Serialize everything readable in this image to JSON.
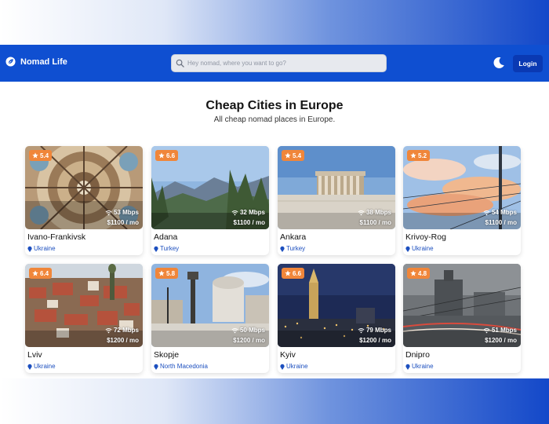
{
  "app": {
    "brand_name": "Nomad Life",
    "colors": {
      "navbar": "#0f4fd1",
      "login": "#0a39b3",
      "rating_badge": "#f0863a",
      "country_link": "#1c4fbf"
    }
  },
  "header": {
    "search_placeholder": "Hey nomad, where you want to go?",
    "login_label": "Login",
    "theme_icon": "moon-icon"
  },
  "main": {
    "title": "Cheap Cities in Europe",
    "subtitle": "All cheap nomad places in Europe."
  },
  "cards": [
    {
      "rating": "5.4",
      "speed": "53 Mbps",
      "cost": "$1100 / mo",
      "city": "Ivano-Frankivsk",
      "country": "Ukraine"
    },
    {
      "rating": "6.6",
      "speed": "32 Mbps",
      "cost": "$1100 / mo",
      "city": "Adana",
      "country": "Turkey"
    },
    {
      "rating": "5.4",
      "speed": "38 Mbps",
      "cost": "$1100 / mo",
      "city": "Ankara",
      "country": "Turkey"
    },
    {
      "rating": "5.2",
      "speed": "54 Mbps",
      "cost": "$1100 / mo",
      "city": "Krivoy-Rog",
      "country": "Ukraine"
    },
    {
      "rating": "6.4",
      "speed": "72 Mbps",
      "cost": "$1200 / mo",
      "city": "Lviv",
      "country": "Ukraine"
    },
    {
      "rating": "5.8",
      "speed": "50 Mbps",
      "cost": "$1200 / mo",
      "city": "Skopje",
      "country": "North Macedonia"
    },
    {
      "rating": "6.6",
      "speed": "79 Mbps",
      "cost": "$1200 / mo",
      "city": "Kyiv",
      "country": "Ukraine"
    },
    {
      "rating": "4.8",
      "speed": "51 Mbps",
      "cost": "$1200 / mo",
      "city": "Dnipro",
      "country": "Ukraine"
    }
  ]
}
